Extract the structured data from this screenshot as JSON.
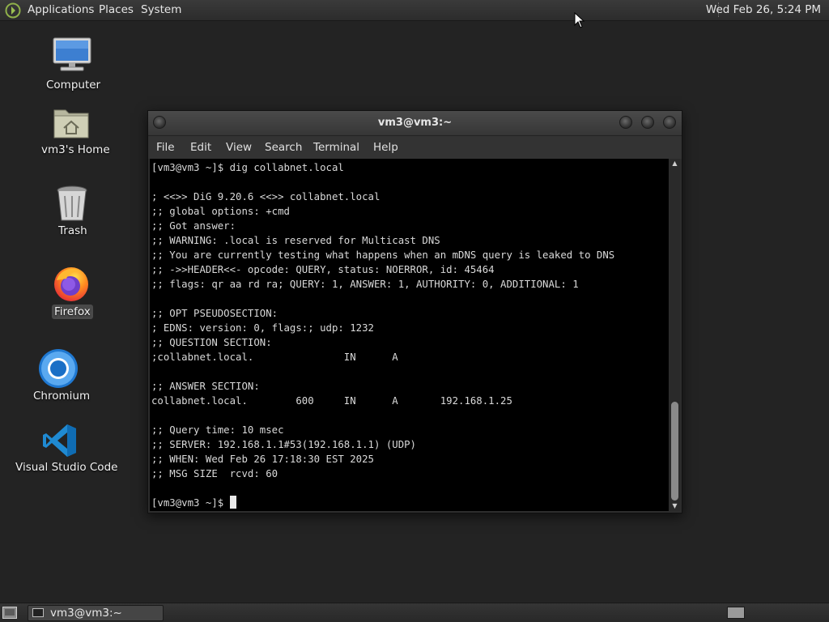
{
  "top_panel": {
    "menus": [
      "Applications",
      "Places",
      "System"
    ],
    "clock": "Wed Feb 26,  5:24 PM"
  },
  "desktop_icons": {
    "computer": "Computer",
    "home": "vm3's Home",
    "trash": "Trash",
    "firefox": "Firefox",
    "chromium": "Chromium",
    "vscode": "Visual Studio Code"
  },
  "terminal": {
    "title": "vm3@vm3:~",
    "menu": [
      "File",
      "Edit",
      "View",
      "Search",
      "Terminal",
      "Help"
    ],
    "lines": [
      "[vm3@vm3 ~]$ dig collabnet.local",
      "",
      "; <<>> DiG 9.20.6 <<>> collabnet.local",
      ";; global options: +cmd",
      ";; Got answer:",
      ";; WARNING: .local is reserved for Multicast DNS",
      ";; You are currently testing what happens when an mDNS query is leaked to DNS",
      ";; ->>HEADER<<- opcode: QUERY, status: NOERROR, id: 45464",
      ";; flags: qr aa rd ra; QUERY: 1, ANSWER: 1, AUTHORITY: 0, ADDITIONAL: 1",
      "",
      ";; OPT PSEUDOSECTION:",
      "; EDNS: version: 0, flags:; udp: 1232",
      ";; QUESTION SECTION:",
      ";collabnet.local.               IN      A",
      "",
      ";; ANSWER SECTION:",
      "collabnet.local.        600     IN      A       192.168.1.25",
      "",
      ";; Query time: 10 msec",
      ";; SERVER: 192.168.1.1#53(192.168.1.1) (UDP)",
      ";; WHEN: Wed Feb 26 17:18:30 EST 2025",
      ";; MSG SIZE  rcvd: 60",
      ""
    ],
    "prompt": "[vm3@vm3 ~]$ "
  },
  "taskbar": {
    "window_label": "vm3@vm3:~"
  }
}
